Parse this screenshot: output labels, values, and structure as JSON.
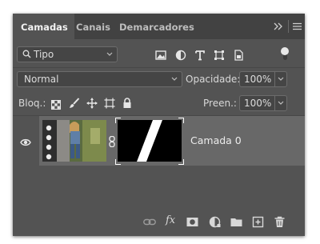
{
  "tabs": [
    "Camadas",
    "Canais",
    "Demarcadores"
  ],
  "filter": {
    "label": "Tipo",
    "icons": [
      "image-filter-icon",
      "adjustment-filter-icon",
      "type-filter-icon",
      "shape-filter-icon",
      "smart-object-filter-icon"
    ]
  },
  "blend": {
    "mode": "Normal",
    "opacity_label": "Opacidade:",
    "opacity_value": "100%"
  },
  "lock": {
    "label": "Bloq.:",
    "fill_label": "Preen.:",
    "fill_value": "100%",
    "icons": [
      "lock-transparent-icon",
      "lock-paint-icon",
      "lock-move-icon",
      "lock-artboard-icon",
      "lock-all-icon"
    ]
  },
  "layers": [
    {
      "name": "Camada 0",
      "visible": true
    }
  ],
  "bottom_icons": [
    "link-layers-icon",
    "fx-icon",
    "add-mask-icon",
    "adjustment-layer-icon",
    "group-folder-icon",
    "new-layer-icon",
    "delete-layer-icon"
  ],
  "bottom_fx": "fx",
  "colors": {
    "panel": "#535353",
    "tabbar": "#424242",
    "layer_selected": "#686868"
  }
}
